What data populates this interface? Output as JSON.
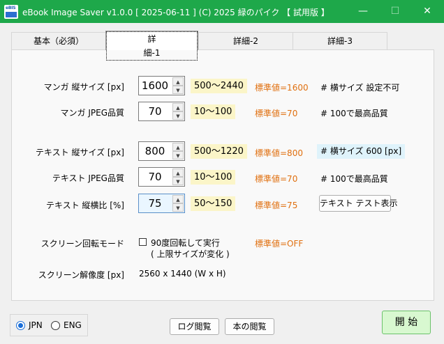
{
  "window": {
    "title": "eBook Image Saver  v1.0.0  [ 2025-06-11 ]   (C) 2025 緑のパイク  【 試用版 】",
    "icon_top_text": "eBIS",
    "min_glyph": "—",
    "max_glyph": "☐",
    "close_glyph": "✕"
  },
  "tabs": [
    {
      "label": "基本（必須）",
      "selected": false
    },
    {
      "label": "詳細-1",
      "selected": true
    },
    {
      "label": "詳細-2",
      "selected": false
    },
    {
      "label": "詳細-3",
      "selected": false
    }
  ],
  "rows": {
    "manga_height": {
      "label": "マンガ 縦サイズ [px]",
      "value": "1600",
      "range": "500〜2440",
      "std": "標準値=1600",
      "note": "# 横サイズ 設定不可"
    },
    "manga_jpeg": {
      "label": "マンガ JPEG品質",
      "value": "70",
      "range": "10〜100",
      "std": "標準値=70",
      "note": "# 100で最高品質"
    },
    "text_height": {
      "label": "テキスト 縦サイズ [px]",
      "value": "800",
      "range": "500〜1220",
      "std": "標準値=800",
      "note": "# 横サイズ 600 [px]"
    },
    "text_jpeg": {
      "label": "テキスト JPEG品質",
      "value": "70",
      "range": "10〜100",
      "std": "標準値=70",
      "note": "# 100で最高品質"
    },
    "text_ratio": {
      "label": "テキスト 縦横比 [%]",
      "value": "75",
      "range": "50〜150",
      "std": "標準値=75",
      "button": "テキスト テスト表示"
    }
  },
  "spinner": {
    "up": "▲",
    "down": "▼"
  },
  "rotation": {
    "label": "スクリーン回転モード",
    "checkbox_label": "90度回転して実行",
    "sub_label": "( 上限サイズが変化 )",
    "checked": false,
    "std": "標準値=OFF"
  },
  "resolution": {
    "label": "スクリーン解像度 [px]",
    "value": "2560 x 1440 (W x H)"
  },
  "language": {
    "options": [
      {
        "label": "JPN",
        "selected": true
      },
      {
        "label": "ENG",
        "selected": false
      }
    ]
  },
  "buttons": {
    "log": "ログ閲覧",
    "book": "本の閲覧",
    "start": "開 始"
  },
  "colors": {
    "titlebar": "#1ea84a",
    "std_text": "#e07010",
    "range_bg": "#fbf5c8",
    "note_hl_bg": "#dff3fb",
    "start_bg": "#d8f8d0"
  }
}
